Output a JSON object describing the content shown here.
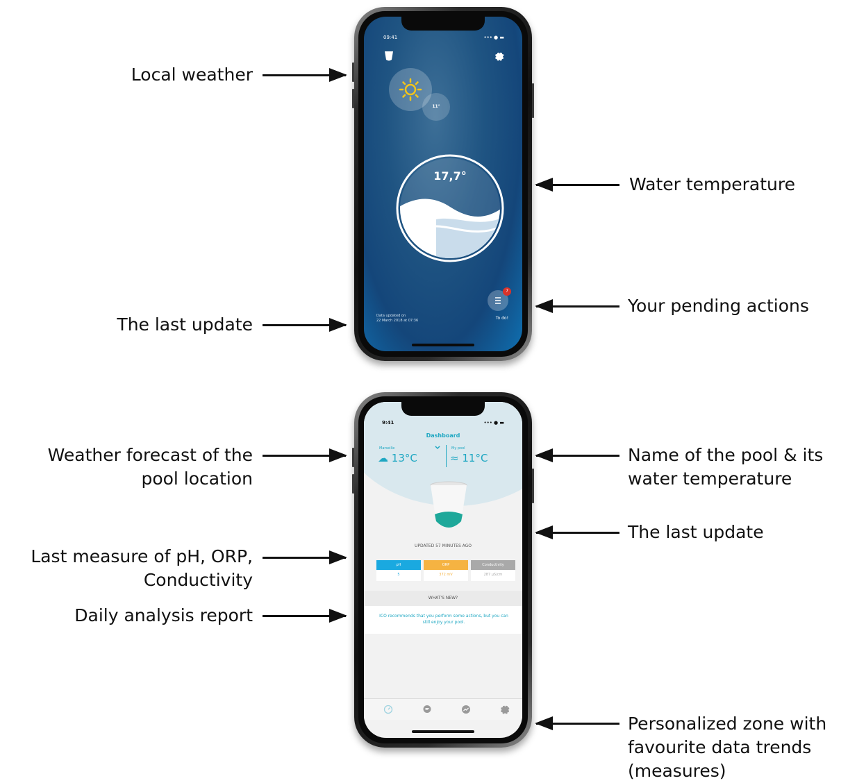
{
  "colors": {
    "accent": "#1ea7c2",
    "ph": "#1aa9e0",
    "orp": "#f5b342",
    "conductivity": "#a9a9a9",
    "badge": "#d9332b"
  },
  "annotations": {
    "local_weather": "Local weather",
    "last_update_top": "The last update",
    "water_temperature": "Water temperature",
    "pending_actions": "Your pending actions",
    "weather_forecast_l1": "Weather forecast of the",
    "weather_forecast_l2": "pool location",
    "pool_name_l1": "Name of the pool & its",
    "pool_name_l2": "water temperature",
    "last_update_bottom": "The last update",
    "last_measure_l1": "Last measure of pH, ORP,",
    "last_measure_l2": "Conductivity",
    "daily_report": "Daily analysis report",
    "personalized_l1": "Personalized zone with",
    "personalized_l2": "favourite data trends",
    "personalized_l3": "(measures)"
  },
  "phone1": {
    "status_time": "09:41",
    "status_icons": "••• ● ▬",
    "weather_icon": "sun-icon",
    "air_temp": "11°",
    "water_temp": "17,7°",
    "todo_count": "7",
    "todo_label": "To do!",
    "update_line1": "Data updated on",
    "update_line2": "22 March 2018 at 07:36"
  },
  "phone2": {
    "status_time": "9:41",
    "status_icons": "••• ● ▬",
    "title": "Dashboard",
    "location_label": "Marseille",
    "location_temp": "13°C",
    "pool_label": "My pool",
    "pool_temp": "11°C",
    "updated": "UPDATED 57 MINUTES AGO",
    "metrics": [
      {
        "label": "pH",
        "value": "5"
      },
      {
        "label": "ORP",
        "value": "372 mV"
      },
      {
        "label": "Conductivity",
        "value": "287 µS/cm"
      }
    ],
    "whats_new": "WHAT'S NEW?",
    "report": "ICO recommends that you perform some actions, but you can still enjoy your pool.",
    "tabs": [
      "gauge-icon",
      "chat-icon",
      "trend-icon",
      "gear-icon"
    ]
  }
}
